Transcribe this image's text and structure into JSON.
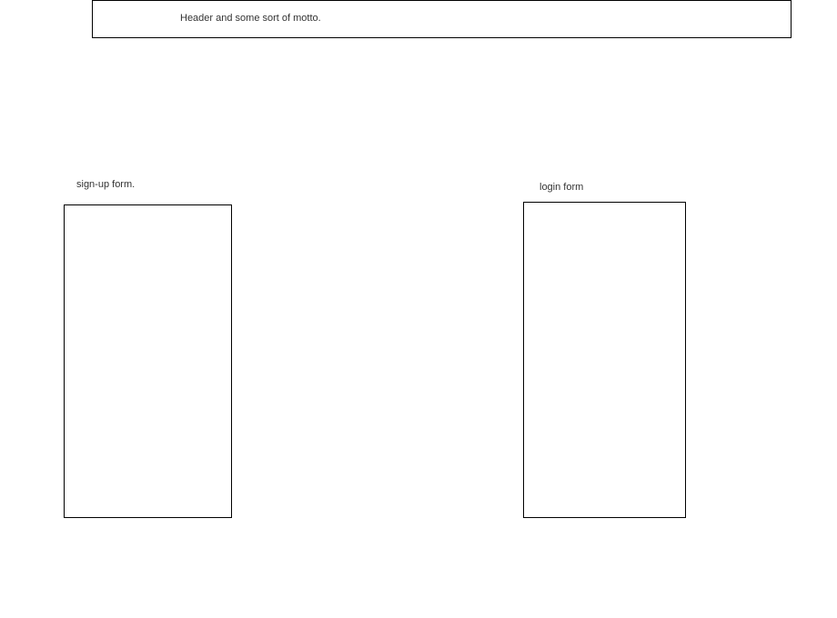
{
  "header": {
    "text": "Header and some sort of motto."
  },
  "signup": {
    "label": "sign-up form."
  },
  "login": {
    "label": "login form"
  }
}
